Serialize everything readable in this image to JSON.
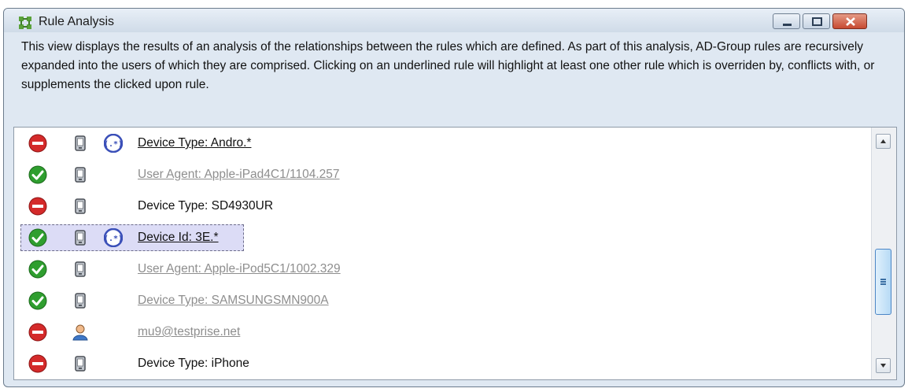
{
  "window": {
    "title": "Rule Analysis",
    "description": "This view displays the results of an analysis of the relationships between the rules which are defined. As part of this analysis, AD-Group rules are recursively expanded into the users of which they are comprised. Clicking on an underlined rule will highlight at least one other rule which is overriden by, conflicts with, or supplements the clicked upon rule.",
    "controls": [
      "minimize-button",
      "maximize-button",
      "close-button"
    ]
  },
  "rules": [
    {
      "label": "Device Type: Andro.*",
      "status": "deny",
      "type": "device",
      "regex": true,
      "style": "link",
      "selected": false
    },
    {
      "label": "User Agent: Apple-iPad4C1/1104.257",
      "status": "allow",
      "type": "device",
      "regex": false,
      "style": "grey",
      "selected": false
    },
    {
      "label": "Device Type: SD4930UR",
      "status": "deny",
      "type": "device",
      "regex": false,
      "style": "plain",
      "selected": false
    },
    {
      "label": "Device Id: 3E.*",
      "status": "allow",
      "type": "device",
      "regex": true,
      "style": "link",
      "selected": true
    },
    {
      "label": "User Agent: Apple-iPod5C1/1002.329",
      "status": "allow",
      "type": "device",
      "regex": false,
      "style": "grey",
      "selected": false
    },
    {
      "label": "Device Type: SAMSUNGSMN900A",
      "status": "allow",
      "type": "device",
      "regex": false,
      "style": "grey",
      "selected": false
    },
    {
      "label": "mu9@testprise.net",
      "status": "deny",
      "type": "user",
      "regex": false,
      "style": "grey",
      "selected": false
    },
    {
      "label": "Device Type: iPhone",
      "status": "deny",
      "type": "device",
      "regex": false,
      "style": "plain",
      "selected": false
    },
    {
      "label": "",
      "status": "allow",
      "type": "device",
      "regex": false,
      "style": "plain",
      "selected": false
    }
  ],
  "icons": {
    "deny": "deny-icon",
    "allow": "allow-icon",
    "device": "device-icon",
    "user": "user-icon",
    "regex": "regex-icon"
  },
  "colors": {
    "deny": "#d42a2a",
    "allow": "#2f9e2f",
    "regex": "#3a4fb8",
    "selection": "#dcdcf6"
  }
}
